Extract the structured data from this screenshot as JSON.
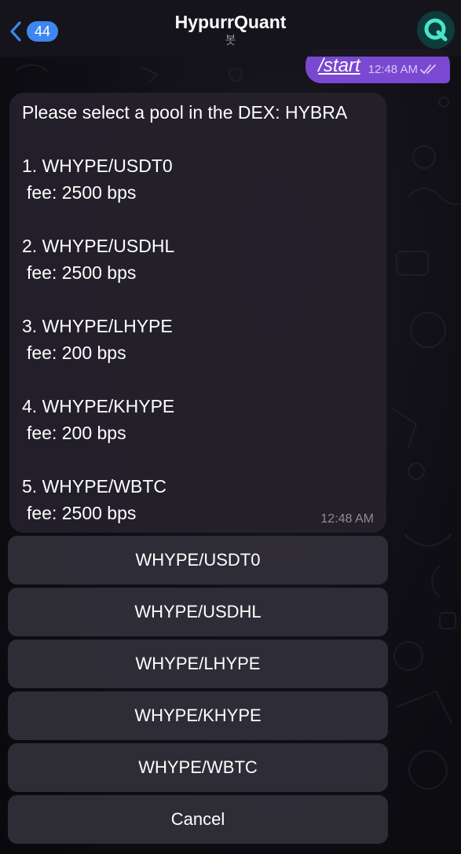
{
  "header": {
    "back_badge": "44",
    "title": "HypurrQuant",
    "subtitle": "봇"
  },
  "colors": {
    "accent": "#3e86f0",
    "outgoing_bubble": "#7a48d1",
    "incoming_bubble": "#25212c",
    "avatar_bg": "#0e3b3c",
    "avatar_q": "#46e6c8"
  },
  "outgoing": {
    "text": "/start",
    "time": "12:48 AM"
  },
  "incoming": {
    "intro": "Please select a pool in the DEX: HYBRA",
    "pools": [
      {
        "line": "1. WHYPE/USDT0",
        "fee": "fee: 2500 bps"
      },
      {
        "line": "2. WHYPE/USDHL",
        "fee": "fee: 2500 bps"
      },
      {
        "line": "3. WHYPE/LHYPE",
        "fee": "fee: 200 bps"
      },
      {
        "line": "4. WHYPE/KHYPE",
        "fee": "fee: 200 bps"
      },
      {
        "line": "5. WHYPE/WBTC",
        "fee": "fee: 2500 bps"
      }
    ],
    "time": "12:48 AM"
  },
  "keyboard": {
    "buttons": [
      "WHYPE/USDT0",
      "WHYPE/USDHL",
      "WHYPE/LHYPE",
      "WHYPE/KHYPE",
      "WHYPE/WBTC",
      "Cancel"
    ]
  }
}
